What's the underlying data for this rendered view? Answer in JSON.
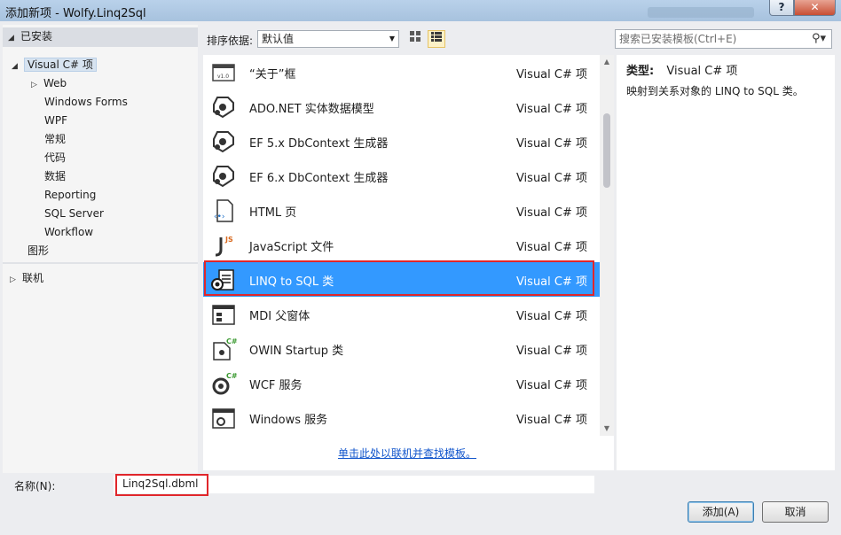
{
  "window": {
    "title": "添加新项 - Wolfy.Linq2Sql",
    "help": "?",
    "close": "✕"
  },
  "tree": {
    "installed": "已安装",
    "visual_csharp": "Visual C# 项",
    "children": [
      "Web",
      "Windows Forms",
      "WPF",
      "常规",
      "代码",
      "数据",
      "Reporting",
      "SQL Server",
      "Workflow"
    ],
    "graphics": "图形",
    "online": "联机"
  },
  "toolbar": {
    "sort_label": "排序依据:",
    "sort_value": "默认值",
    "search_placeholder": "搜索已安装模板(Ctrl+E)"
  },
  "items": [
    {
      "name": "“关于”框",
      "lang": "Visual C# 项",
      "icon": "about-box-icon"
    },
    {
      "name": "ADO.NET 实体数据模型",
      "lang": "Visual C# 项",
      "icon": "entity-model-icon"
    },
    {
      "name": "EF 5.x DbContext 生成器",
      "lang": "Visual C# 项",
      "icon": "dbcontext-icon"
    },
    {
      "name": "EF 6.x DbContext 生成器",
      "lang": "Visual C# 项",
      "icon": "dbcontext-icon"
    },
    {
      "name": "HTML 页",
      "lang": "Visual C# 项",
      "icon": "html-page-icon"
    },
    {
      "name": "JavaScript 文件",
      "lang": "Visual C# 项",
      "icon": "javascript-file-icon"
    },
    {
      "name": "LINQ to SQL 类",
      "lang": "Visual C# 项",
      "icon": "linq-to-sql-icon",
      "selected": true
    },
    {
      "name": "MDI 父窗体",
      "lang": "Visual C# 项",
      "icon": "mdi-form-icon"
    },
    {
      "name": "OWIN Startup 类",
      "lang": "Visual C# 项",
      "icon": "owin-startup-icon"
    },
    {
      "name": "WCF 服务",
      "lang": "Visual C# 项",
      "icon": "wcf-service-icon"
    },
    {
      "name": "Windows 服务",
      "lang": "Visual C# 项",
      "icon": "windows-service-icon"
    }
  ],
  "online_link": "单击此处以联机并查找模板。",
  "details": {
    "type_label": "类型:",
    "type_value": "Visual C# 项",
    "description": "映射到关系对象的 LINQ to SQL 类。"
  },
  "bottom": {
    "name_label": "名称(N):",
    "name_value": "Linq2Sql.dbml",
    "add_button": "添加(A)",
    "cancel_button": "取消"
  },
  "colors": {
    "selection": "#3399ff",
    "highlight_box": "#e0262b",
    "link": "#1155cc"
  }
}
